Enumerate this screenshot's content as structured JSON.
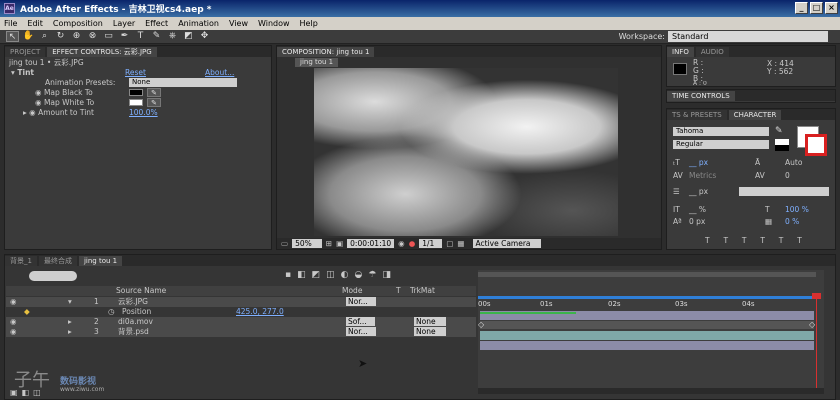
{
  "title": "Adobe After Effects - 吉林卫视cs4.aep *",
  "app_icon": "Ae",
  "window_buttons": [
    "_",
    "□",
    "×"
  ],
  "menu": [
    "File",
    "Edit",
    "Composition",
    "Layer",
    "Effect",
    "Animation",
    "View",
    "Window",
    "Help"
  ],
  "tools": [
    "selection-arrow",
    "hand",
    "zoom",
    "rotate",
    "camera-orbit",
    "pan-behind",
    "rectangle-mask",
    "pen",
    "type",
    "brush",
    "clone-stamp",
    "eraser",
    "puppet-pin"
  ],
  "tool_glyphs": [
    "↖",
    "✋",
    "⌕",
    "↻",
    "⊕",
    "⊗",
    "▭",
    "✒",
    "T",
    "✎",
    "⎈",
    "◩",
    "✥"
  ],
  "workspace": {
    "label": "Workspace:",
    "value": "Standard"
  },
  "project_panel": {
    "tabs": [
      "PROJECT",
      "EFFECT CONTROLS: 云彩.JPG"
    ],
    "breadcrumb": "jing tou 1 • 云彩.JPG",
    "effect": {
      "name": "Tint",
      "reset": "Reset",
      "about": "About..."
    },
    "params": [
      {
        "label": "Animation Presets:",
        "value": "None"
      },
      {
        "label": "Map Black To",
        "value": ""
      },
      {
        "label": "Map White To",
        "value": ""
      },
      {
        "label": "Amount to Tint",
        "value": "100.0%"
      }
    ],
    "colors": {
      "black": "#000000",
      "white": "#ffffff"
    }
  },
  "composition": {
    "tab": "COMPOSITION: jing tou 1",
    "subtab": "jing tou 1",
    "zoom": "50%",
    "timecode": "0:00:01:10",
    "resolution": "1/1",
    "camera": "Active Camera"
  },
  "info_panel": {
    "tabs": [
      "INFO",
      "AUDIO"
    ],
    "r": "R :",
    "g": "G :",
    "b": "B :",
    "a": "A : 0",
    "x": "X : 414",
    "y": "Y : 562"
  },
  "time_controls": {
    "tab": "TIME CONTROLS"
  },
  "character_panel": {
    "tabs": [
      "TS & PRESETS",
      "CHARACTER"
    ],
    "font": "Tahoma",
    "style": "Regular",
    "size": "__ px",
    "leading": "Auto",
    "kerning": "Metrics",
    "tracking": "0",
    "stroke": "__ px",
    "vscale": "__ %",
    "hscale": "100 %",
    "baseline": "0 px",
    "tsume": "0 %"
  },
  "timeline": {
    "tabs": [
      "背景_1",
      "最终合成",
      "jing tou 1"
    ],
    "search_placeholder": "",
    "columns": {
      "source": "Source Name",
      "mode": "Mode",
      "t": "T",
      "trkmat": "TrkMat"
    },
    "layers": [
      {
        "num": "1",
        "name": "云彩.JPG",
        "mode": "Nor...",
        "trkmat": ""
      },
      {
        "num": "",
        "name": "Position",
        "value": "425.0, 277.0",
        "mode": "",
        "trkmat": ""
      },
      {
        "num": "2",
        "name": "di0a.mov",
        "mode": "Sof...",
        "trkmat": "None"
      },
      {
        "num": "3",
        "name": "背景.psd",
        "mode": "Nor...",
        "trkmat": "None"
      }
    ],
    "ruler": [
      "00s",
      "01s",
      "02s",
      "03s",
      "04s"
    ],
    "colors": {
      "layer1": "#8c8ca8",
      "layer2": "#7fa8a8",
      "layer3": "#8c8ca8",
      "workarea": "#2f7fd8",
      "playhead": "#d83030"
    }
  },
  "watermark": {
    "logo": "子午",
    "text": "数码影视",
    "url": "www.ziwu.com"
  }
}
